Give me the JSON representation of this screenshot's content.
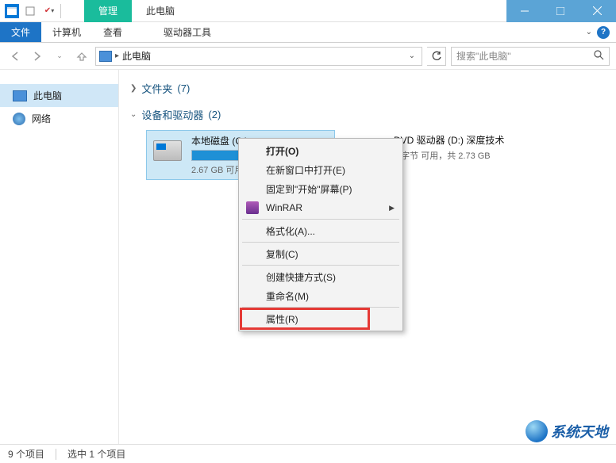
{
  "titlebar": {
    "context_tab": "管理",
    "title_tab": "此电脑"
  },
  "ribbon": {
    "file": "文件",
    "tabs": [
      "计算机",
      "查看"
    ],
    "context_tab": "驱动器工具"
  },
  "nav": {
    "location": "此电脑",
    "search_placeholder": "搜索\"此电脑\""
  },
  "sidebar": {
    "items": [
      {
        "label": "此电脑",
        "selected": true
      },
      {
        "label": "网络",
        "selected": false
      }
    ]
  },
  "groups": {
    "folders": {
      "label": "文件夹",
      "count": "(7)"
    },
    "devices": {
      "label": "设备和驱动器",
      "count": "(2)"
    }
  },
  "drives": [
    {
      "name": "本地磁盘 (C:)",
      "sub": "2.67 GB 可用",
      "fill_pct": 78,
      "selected": true,
      "type": "hdd"
    },
    {
      "name": "DVD 驱动器 (D:) 深度技术",
      "sub": "0 字节 可用，共 2.73 GB",
      "fill_pct": 0,
      "selected": false,
      "type": "dvd"
    }
  ],
  "context_menu": {
    "items": [
      {
        "label": "打开(O)",
        "bold": true
      },
      {
        "label": "在新窗口中打开(E)"
      },
      {
        "label": "固定到\"开始\"屏幕(P)"
      },
      {
        "label": "WinRAR",
        "icon": "winrar",
        "submenu": true
      },
      {
        "sep": true
      },
      {
        "label": "格式化(A)..."
      },
      {
        "sep": true
      },
      {
        "label": "复制(C)"
      },
      {
        "sep": true
      },
      {
        "label": "创建快捷方式(S)"
      },
      {
        "label": "重命名(M)"
      },
      {
        "sep": true
      },
      {
        "label": "属性(R)",
        "highlight": true
      }
    ]
  },
  "statusbar": {
    "items_count": "9 个项目",
    "selected_count": "选中 1 个项目"
  },
  "watermark": "系统天地"
}
